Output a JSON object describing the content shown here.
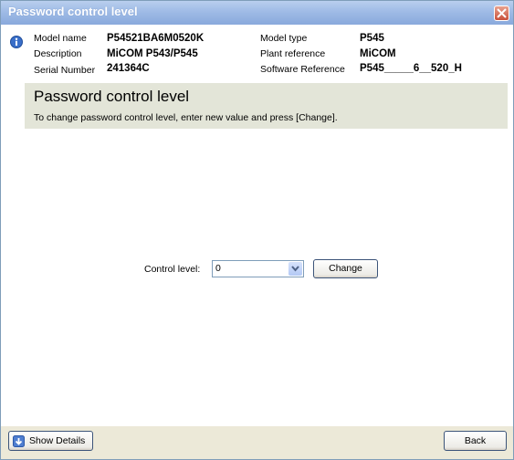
{
  "window": {
    "title": "Password control level"
  },
  "device": {
    "model_name_label": "Model name",
    "model_name_value": "P54521BA6M0520K",
    "description_label": "Description",
    "description_value": "MiCOM P543/P545",
    "serial_number_label": "Serial Number",
    "serial_number_value": "241364C",
    "model_type_label": "Model type",
    "model_type_value": "P545",
    "plant_reference_label": "Plant reference",
    "plant_reference_value": "MiCOM",
    "software_reference_label": "Software Reference",
    "software_reference_value": "P545_____6__520_H"
  },
  "banner": {
    "title": "Password control level",
    "description": "To change password control level, enter new value and press [Change]."
  },
  "form": {
    "control_level_label": "Control level:",
    "control_level_value": "0",
    "change_label": "Change"
  },
  "footer": {
    "show_details_label": "Show Details",
    "back_label": "Back"
  }
}
